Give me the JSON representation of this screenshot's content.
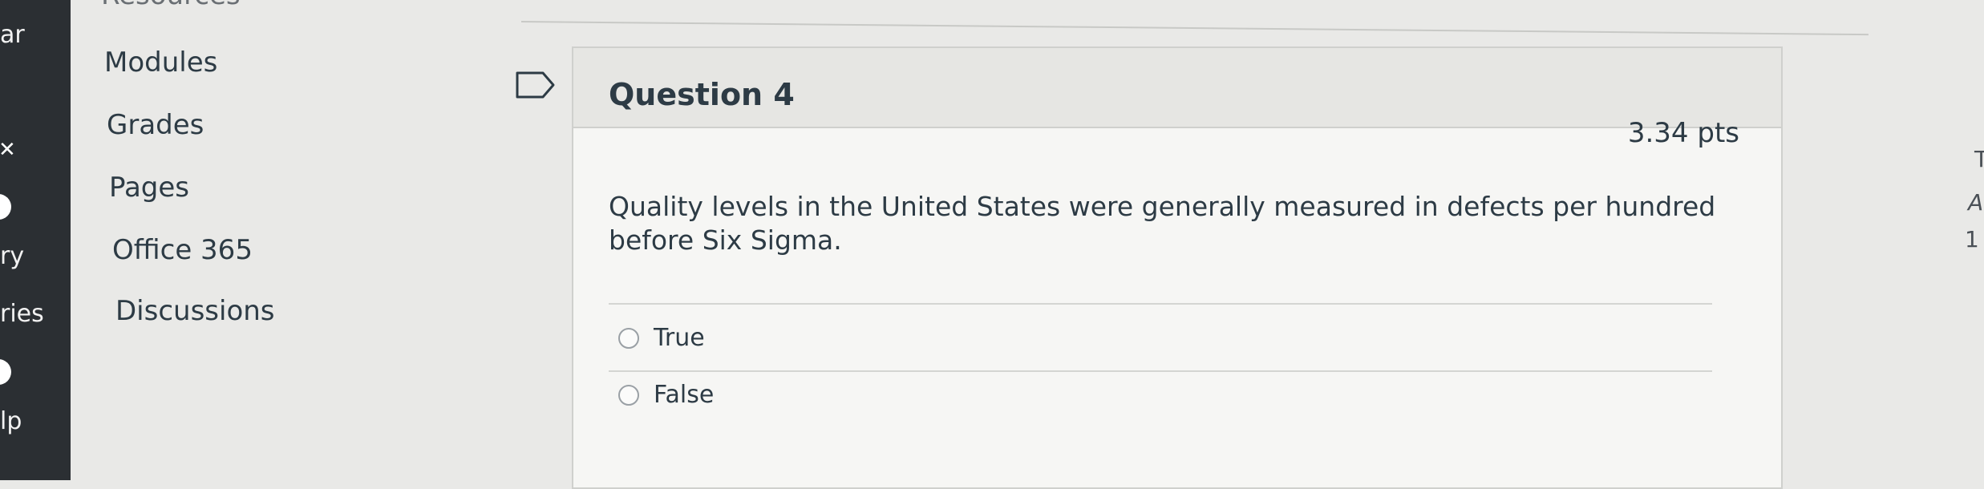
{
  "global_nav": {
    "items": [
      "ar",
      "ry",
      "ries",
      "lp"
    ]
  },
  "course_nav": {
    "items": [
      "Resources",
      "Modules",
      "Grades",
      "Pages",
      "Office 365",
      "Discussions"
    ]
  },
  "question": {
    "title": "Question 4",
    "points": "3.34 pts",
    "text": "Quality levels in the United States were generally measured in defects per hundred before Six Sigma.",
    "answers": [
      "True",
      "False"
    ]
  },
  "right_edge": [
    "T",
    "A",
    "1"
  ]
}
